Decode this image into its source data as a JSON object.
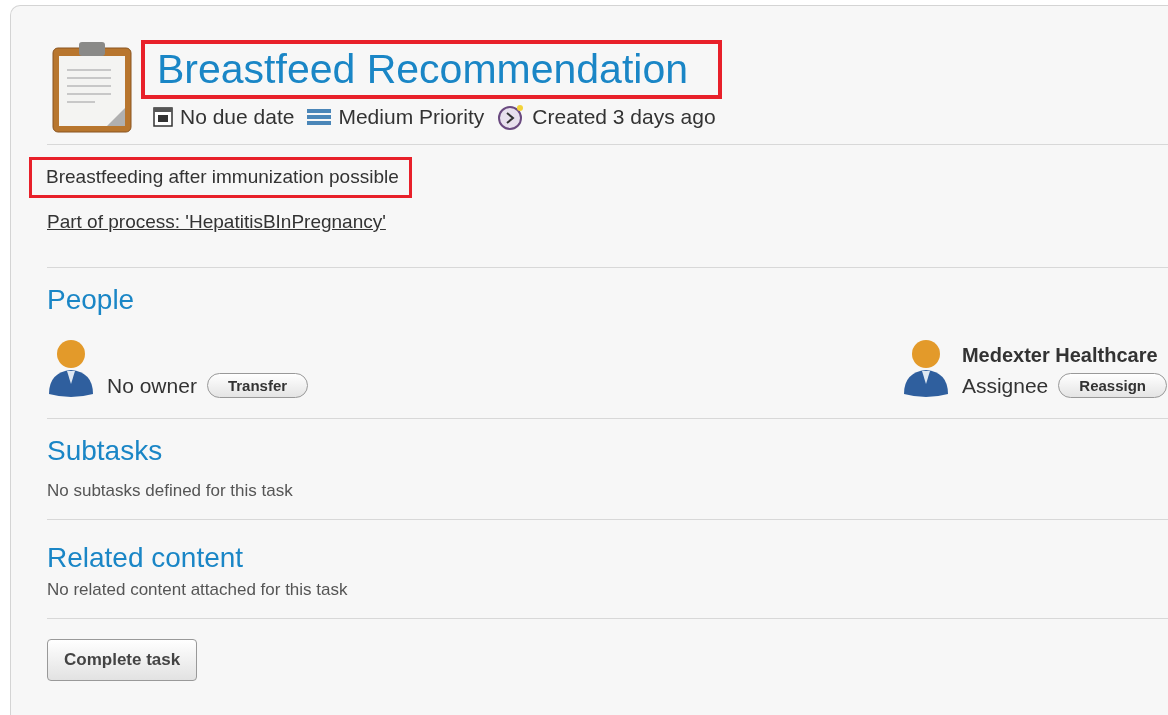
{
  "task": {
    "title": "Breastfeed Recommendation",
    "title_highlighted": true,
    "meta": [
      {
        "kind": "calendar",
        "text": "No due date"
      },
      {
        "kind": "priority",
        "text": "Medium Priority"
      },
      {
        "kind": "clock",
        "text": "Created 3 days ago"
      }
    ],
    "description": "Breastfeeding after immunization possible",
    "description_highlighted": true,
    "process_link": "Part of process: 'HepatitisBInPregnancy'"
  },
  "people": {
    "heading": "People",
    "entries": [
      {
        "role": "No owner",
        "button": "Transfer"
      },
      {
        "name": "Medexter Healthcare",
        "role": "Assignee",
        "button": "Reassign"
      }
    ]
  },
  "subtasks": {
    "heading": "Subtasks",
    "text": "No subtasks defined for this task"
  },
  "related": {
    "heading": "Related content",
    "text": "No related content attached for this task"
  },
  "action_button": "Complete task"
}
